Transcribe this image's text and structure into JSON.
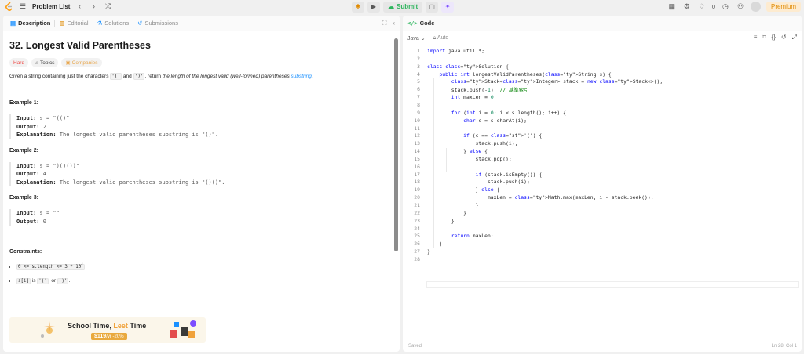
{
  "topbar": {
    "problem_list": "Problem List",
    "submit": "Submit",
    "streak": "0",
    "premium": "Premium"
  },
  "left_tabs": {
    "description": "Description",
    "editorial": "Editorial",
    "solutions": "Solutions",
    "submissions": "Submissions"
  },
  "problem": {
    "title": "32. Longest Valid Parentheses",
    "difficulty": "Hard",
    "topics": "Topics",
    "companies": "Companies",
    "desc_pre": "Given a string containing just the characters ",
    "char_open": "'('",
    "and": " and ",
    "char_close": "')'",
    "desc_mid": ", return ",
    "desc_em": "the length of the longest valid (well-formed) parentheses ",
    "desc_link": "substring",
    "desc_end": "."
  },
  "examples": [
    {
      "title": "Example 1:",
      "input_label": "Input:",
      "input": "s = \"(()\"",
      "output_label": "Output:",
      "output": "2",
      "explanation_label": "Explanation:",
      "explanation": "The longest valid parentheses substring is \"()\"."
    },
    {
      "title": "Example 2:",
      "input_label": "Input:",
      "input": "s = \")()())\"",
      "output_label": "Output:",
      "output": "4",
      "explanation_label": "Explanation:",
      "explanation": "The longest valid parentheses substring is \"()()\"."
    },
    {
      "title": "Example 3:",
      "input_label": "Input:",
      "input": "s = \"\"",
      "output_label": "Output:",
      "output": "0"
    }
  ],
  "constraints": {
    "title": "Constraints:",
    "c1_pre": "0 <= s.length <= 3 * 10",
    "c1_exp": "4",
    "c2_code": "s[i]",
    "c2_mid": " is ",
    "c2_a": "'('",
    "c2_or": ", or ",
    "c2_b": "')'",
    "c2_end": "."
  },
  "banner": {
    "text_a": "School Time, ",
    "text_b": "Leet",
    "text_c": " Time",
    "price": "$119",
    "price_suffix": "/yr",
    "price_tag": "-20%"
  },
  "code_panel": {
    "title": "Code",
    "language": "Java",
    "auto": "Auto",
    "saved": "Saved",
    "position": "Ln 28, Col 1"
  },
  "code": [
    "import java.util.*;",
    "",
    "class Solution {",
    "    public int longestValidParentheses(String s) {",
    "        Stack<Integer> stack = new Stack<>();",
    "        stack.push(-1); // 基準索引",
    "        int maxLen = 0;",
    "",
    "        for (int i = 0; i < s.length(); i++) {",
    "            char c = s.charAt(i);",
    "",
    "            if (c == '(') {",
    "                stack.push(i);",
    "            } else {",
    "                stack.pop();",
    "",
    "                if (stack.isEmpty()) {",
    "                    stack.push(i);",
    "                } else {",
    "                    maxLen = Math.max(maxLen, i - stack.peek());",
    "                }",
    "            }",
    "        }",
    "",
    "        return maxLen;",
    "    }",
    "}",
    ""
  ]
}
